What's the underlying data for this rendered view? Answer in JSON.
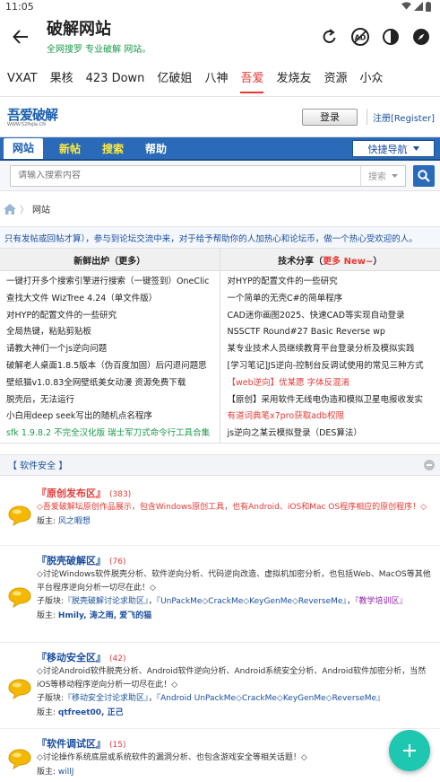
{
  "status": {
    "time": "11:05"
  },
  "app": {
    "title": "破解网站",
    "subtitle": "全网搜罗 专业破解 网站。"
  },
  "tabs": [
    {
      "label": "VXAT"
    },
    {
      "label": "果核"
    },
    {
      "label": "423 Down"
    },
    {
      "label": "亿破姐"
    },
    {
      "label": "八神"
    },
    {
      "label": "吾爱"
    },
    {
      "label": "发烧友"
    },
    {
      "label": "资源"
    },
    {
      "label": "小众"
    }
  ],
  "tab_active_index": 5,
  "site": {
    "logo_text": "吾爱破解",
    "logo_sub": "WWW.52PoJie.CN",
    "login_label": "登录",
    "register_label": "注册[Register]"
  },
  "nav": {
    "items": [
      {
        "label": "网站"
      },
      {
        "label": "新帖"
      },
      {
        "label": "搜索"
      },
      {
        "label": "帮助"
      }
    ],
    "quick_nav": "快捷导航"
  },
  "search": {
    "placeholder": "请输入搜索内容",
    "scope": "搜索"
  },
  "breadcrumb": {
    "current": "网站"
  },
  "notice": "只有发帖或回帖才算），参与到论坛交流中来，对于给予帮助你的人加热心和论坛币，做一个热心受欢迎的人。",
  "hot": {
    "left_title": "新鲜出炉（更多）",
    "right_title": "技术分享（",
    "right_more": "更多 New~",
    "right_close": "）",
    "left_items": [
      {
        "text": "一键打开多个搜索引擎进行搜索（一键签到）OneClic",
        "color": ""
      },
      {
        "text": "查找大文件 WizTree 4.24（单文件版）",
        "color": ""
      },
      {
        "text": "对HYP的配置文件的一些研究",
        "color": ""
      },
      {
        "text": "全局热键，粘贴剪贴板",
        "color": ""
      },
      {
        "text": "请教大神们一个js逆向问题",
        "color": ""
      },
      {
        "text": "破解老人桌面1.8.5版本（伪百度加固）后闪退问题思",
        "color": ""
      },
      {
        "text": "壁纸猫v1.0.83全网壁纸美女动漫 资源免费下载",
        "color": ""
      },
      {
        "text": "脱壳后，无法运行",
        "color": ""
      },
      {
        "text": "小白用deep seek写出的随机点名程序",
        "color": ""
      },
      {
        "text": "sfk 1.9.8.2 不完全汉化版 瑞士军刀式命令行工具合集",
        "color": "green"
      }
    ],
    "right_items": [
      {
        "text": "对HYP的配置文件的一些研究",
        "color": ""
      },
      {
        "text": "一个简单的无壳C#的简单程序",
        "color": ""
      },
      {
        "text": "CAD迷你画图2025、快速CAD等实现自动登录",
        "color": ""
      },
      {
        "text": "NSSCTF Round#27 Basic Reverse wp",
        "color": ""
      },
      {
        "text": "某专业技术人员继续教育平台登录分析及模拟实践",
        "color": ""
      },
      {
        "text": "[学习笔记]JS逆向-控制台反调试使用的常见三种方式",
        "color": ""
      },
      {
        "text": "【web逆向】优某愿 字体反混淆",
        "color": "red"
      },
      {
        "text": "【原创】采用软件无线电伪造和模拟卫星电报收发实",
        "color": ""
      },
      {
        "text": "有道词典笔x7pro获取adb权限",
        "color": "red"
      },
      {
        "text": "js逆向之某云模拟登录（DES算法）",
        "color": ""
      }
    ]
  },
  "section": {
    "title": "【 软件安全 】"
  },
  "forums": [
    {
      "title": "『原创发布区』",
      "count": "(383)",
      "title_red": true,
      "desc": "◇吾爱破解坛原创作品展示，包含Windows原创工具，也有Android、iOS和Mac OS程序相应的原创程序！◇",
      "desc_red": true,
      "sub_prefix": "",
      "sub_links": [],
      "mod_label": "版主:",
      "mods": "风之暇想"
    },
    {
      "title": "『脱壳破解区』",
      "count": "(76)",
      "title_red": false,
      "desc": "◇讨论Windows软件脱壳分析、软件逆向分析、代码逆向改造、虚拟机加密分析，也包括Web、MacOS等其他平台程序逆向分析一切尽在此！◇",
      "desc_red": false,
      "sub_prefix": "子版块:",
      "sub_links": [
        "『脱壳破解讨论求助区』",
        "『UnPackMe◇CrackMe◇KeyGenMe◇ReverseMe』",
        "『教学培训区』"
      ],
      "mod_label": "版主:",
      "mods": "Hmily, 涛之雨, 爱飞的猫"
    },
    {
      "title": "『移动安全区』",
      "count": "(42)",
      "title_red": false,
      "desc": "◇讨论Android软件脱壳分析、Android软件逆向分析、Android系统安全分析、Android软件加密分析，当然iOS等移动程序逆向分析一切尽在此！◇",
      "desc_red": false,
      "sub_prefix": "子版块:",
      "sub_links": [
        "『移动安全讨论求助区』",
        "『Android UnPackMe◇CrackMe◇KeyGenMe◇ReverseMe』"
      ],
      "mod_label": "版主:",
      "mods": "qtfreet00, 正己"
    },
    {
      "title": "『软件调试区』",
      "count": "(15)",
      "title_red": false,
      "desc": "◇讨论操作系统底层或系统软件的漏洞分析、也包含游戏安全等相关话题！◇",
      "desc_red": false,
      "sub_prefix": "",
      "sub_links": [],
      "mod_label": "版主:",
      "mods": "willJ"
    }
  ],
  "colors": {
    "accent_red": "#e53935",
    "nav_blue": "#2a6ab8",
    "fab_teal": "#1ec8b0",
    "link_blue": "#1b4fa0"
  }
}
